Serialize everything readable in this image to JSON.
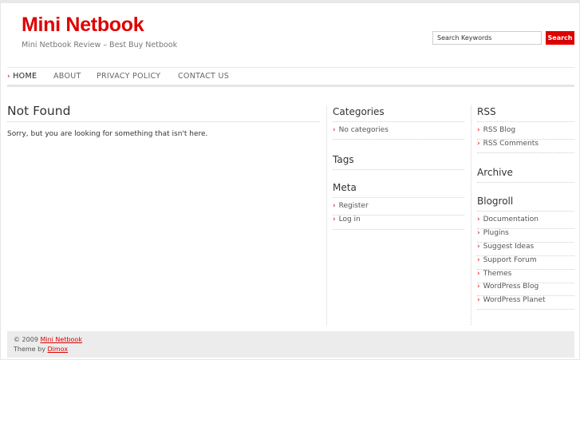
{
  "header": {
    "logo": "Mini Netbook",
    "tagline": "Mini Netbook Review – Best Buy Netbook"
  },
  "search": {
    "value": "Search Keywords",
    "button_label": "Search"
  },
  "nav": {
    "items": [
      {
        "label": "HOME",
        "active": true
      },
      {
        "label": "ABOUT",
        "active": false
      },
      {
        "label": "PRIVACY POLICY",
        "active": false
      },
      {
        "label": "CONTACT US",
        "active": false
      }
    ]
  },
  "main": {
    "title": "Not Found",
    "message": "Sorry, but you are looking for something that isn't here."
  },
  "sidebar_left": {
    "categories": {
      "title": "Categories",
      "items": [
        "No categories"
      ]
    },
    "tags": {
      "title": "Tags"
    },
    "meta": {
      "title": "Meta",
      "items": [
        "Register",
        "Log in"
      ]
    }
  },
  "sidebar_right": {
    "rss": {
      "title": "RSS",
      "items": [
        "RSS Blog",
        "RSS Comments"
      ]
    },
    "archive": {
      "title": "Archive"
    },
    "blogroll": {
      "title": "Blogroll",
      "items": [
        "Documentation",
        "Plugins",
        "Suggest Ideas",
        "Support Forum",
        "Themes",
        "WordPress Blog",
        "WordPress Planet"
      ]
    }
  },
  "footer": {
    "copyright_prefix": "© 2009",
    "copyright_link": "Mini Netbook",
    "theme_prefix": "Theme by",
    "theme_link": "Dimox"
  },
  "colors": {
    "accent": "#dd0000",
    "footer_bg": "#ececec"
  },
  "icons": {
    "bullet": "chevron-right-icon"
  }
}
